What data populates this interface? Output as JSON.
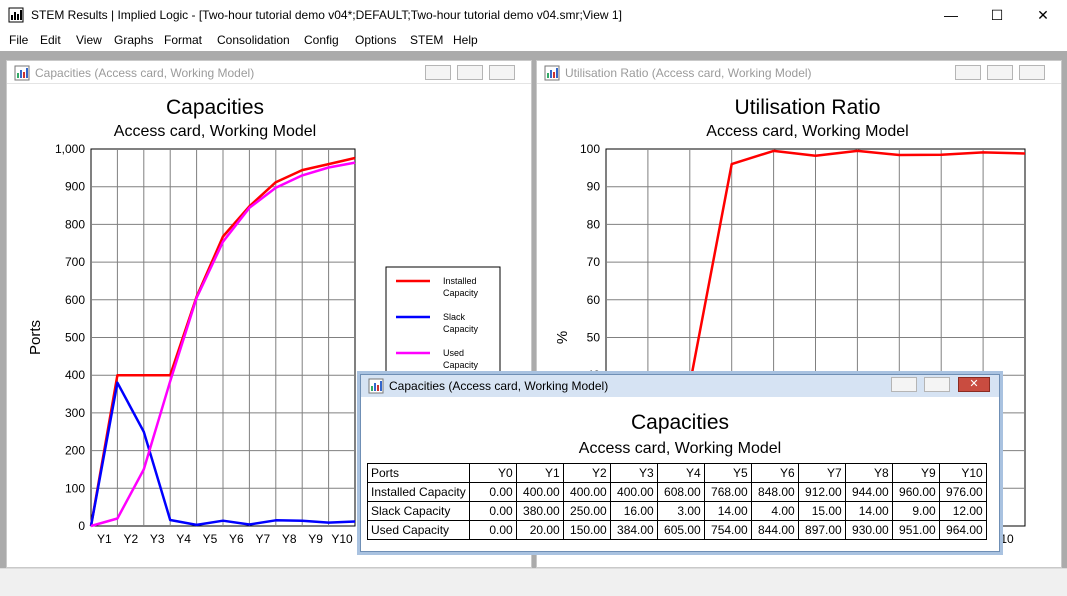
{
  "window": {
    "title": "STEM Results | Implied Logic - [Two-hour tutorial demo v04*;DEFAULT;Two-hour tutorial demo v04.smr;View 1]",
    "minimize": "—",
    "maximize": "☐",
    "close": "✕"
  },
  "menu": [
    "File",
    "Edit",
    "View",
    "Graphs",
    "Format",
    "Consolidation",
    "Config",
    "Options",
    "STEM",
    "Help"
  ],
  "capacities_window": {
    "title": "Capacities (Access card, Working Model)"
  },
  "utilisation_window": {
    "title": "Utilisation Ratio (Access card, Working Model)"
  },
  "table_window": {
    "title": "Capacities (Access card, Working Model)",
    "heading": "Capacities",
    "subheading": "Access card, Working Model",
    "columns": [
      "Ports",
      "Y0",
      "Y1",
      "Y2",
      "Y3",
      "Y4",
      "Y5",
      "Y6",
      "Y7",
      "Y8",
      "Y9",
      "Y10"
    ],
    "rows": [
      {
        "label": "Installed Capacity",
        "values": [
          "0.00",
          "400.00",
          "400.00",
          "400.00",
          "608.00",
          "768.00",
          "848.00",
          "912.00",
          "944.00",
          "960.00",
          "976.00"
        ]
      },
      {
        "label": "Slack Capacity",
        "values": [
          "0.00",
          "380.00",
          "250.00",
          "16.00",
          "3.00",
          "14.00",
          "4.00",
          "15.00",
          "14.00",
          "9.00",
          "12.00"
        ]
      },
      {
        "label": "Used Capacity",
        "values": [
          "0.00",
          "20.00",
          "150.00",
          "384.00",
          "605.00",
          "754.00",
          "844.00",
          "897.00",
          "930.00",
          "951.00",
          "964.00"
        ]
      }
    ]
  },
  "chart_data": [
    {
      "type": "line",
      "title": "Capacities",
      "subtitle": "Access card, Working Model",
      "xlabel": "",
      "ylabel": "Ports",
      "categories": [
        "Y0",
        "Y1",
        "Y2",
        "Y3",
        "Y4",
        "Y5",
        "Y6",
        "Y7",
        "Y8",
        "Y9",
        "Y10"
      ],
      "tick_labels": [
        "Y1",
        "Y2",
        "Y3",
        "Y4",
        "Y5",
        "Y6",
        "Y7",
        "Y8",
        "Y9",
        "Y10"
      ],
      "ylim": [
        0,
        1000
      ],
      "yticks": [
        "0",
        "100",
        "200",
        "300",
        "400",
        "500",
        "600",
        "700",
        "800",
        "900",
        "1,000"
      ],
      "grid": true,
      "legend": "right",
      "series": [
        {
          "name": "Installed Capacity",
          "color": "#ff0000",
          "values": [
            0,
            400,
            400,
            400,
            608,
            768,
            848,
            912,
            944,
            960,
            976
          ]
        },
        {
          "name": "Slack Capacity",
          "color": "#0000ff",
          "values": [
            0,
            380,
            250,
            16,
            3,
            14,
            4,
            15,
            14,
            9,
            12
          ]
        },
        {
          "name": "Used Capacity",
          "color": "#ff00ff",
          "values": [
            0,
            20,
            150,
            384,
            605,
            754,
            844,
            897,
            930,
            951,
            964
          ]
        }
      ]
    },
    {
      "type": "line",
      "title": "Utilisation Ratio",
      "subtitle": "Access card, Working Model",
      "xlabel": "",
      "ylabel": "%",
      "categories": [
        "Y0",
        "Y1",
        "Y2",
        "Y3",
        "Y4",
        "Y5",
        "Y6",
        "Y7",
        "Y8",
        "Y9",
        "Y10"
      ],
      "ylim": [
        0,
        100
      ],
      "visible_yticks": [
        "40",
        "50",
        "60",
        "70",
        "80",
        "90",
        "100"
      ],
      "visible_tick_label": "10",
      "grid": true,
      "series": [
        {
          "color": "#ff0000",
          "values": [
            0,
            5,
            37.5,
            96,
            99.5,
            98.2,
            99.5,
            98.4,
            98.5,
            99.1,
            98.8
          ]
        }
      ]
    }
  ]
}
